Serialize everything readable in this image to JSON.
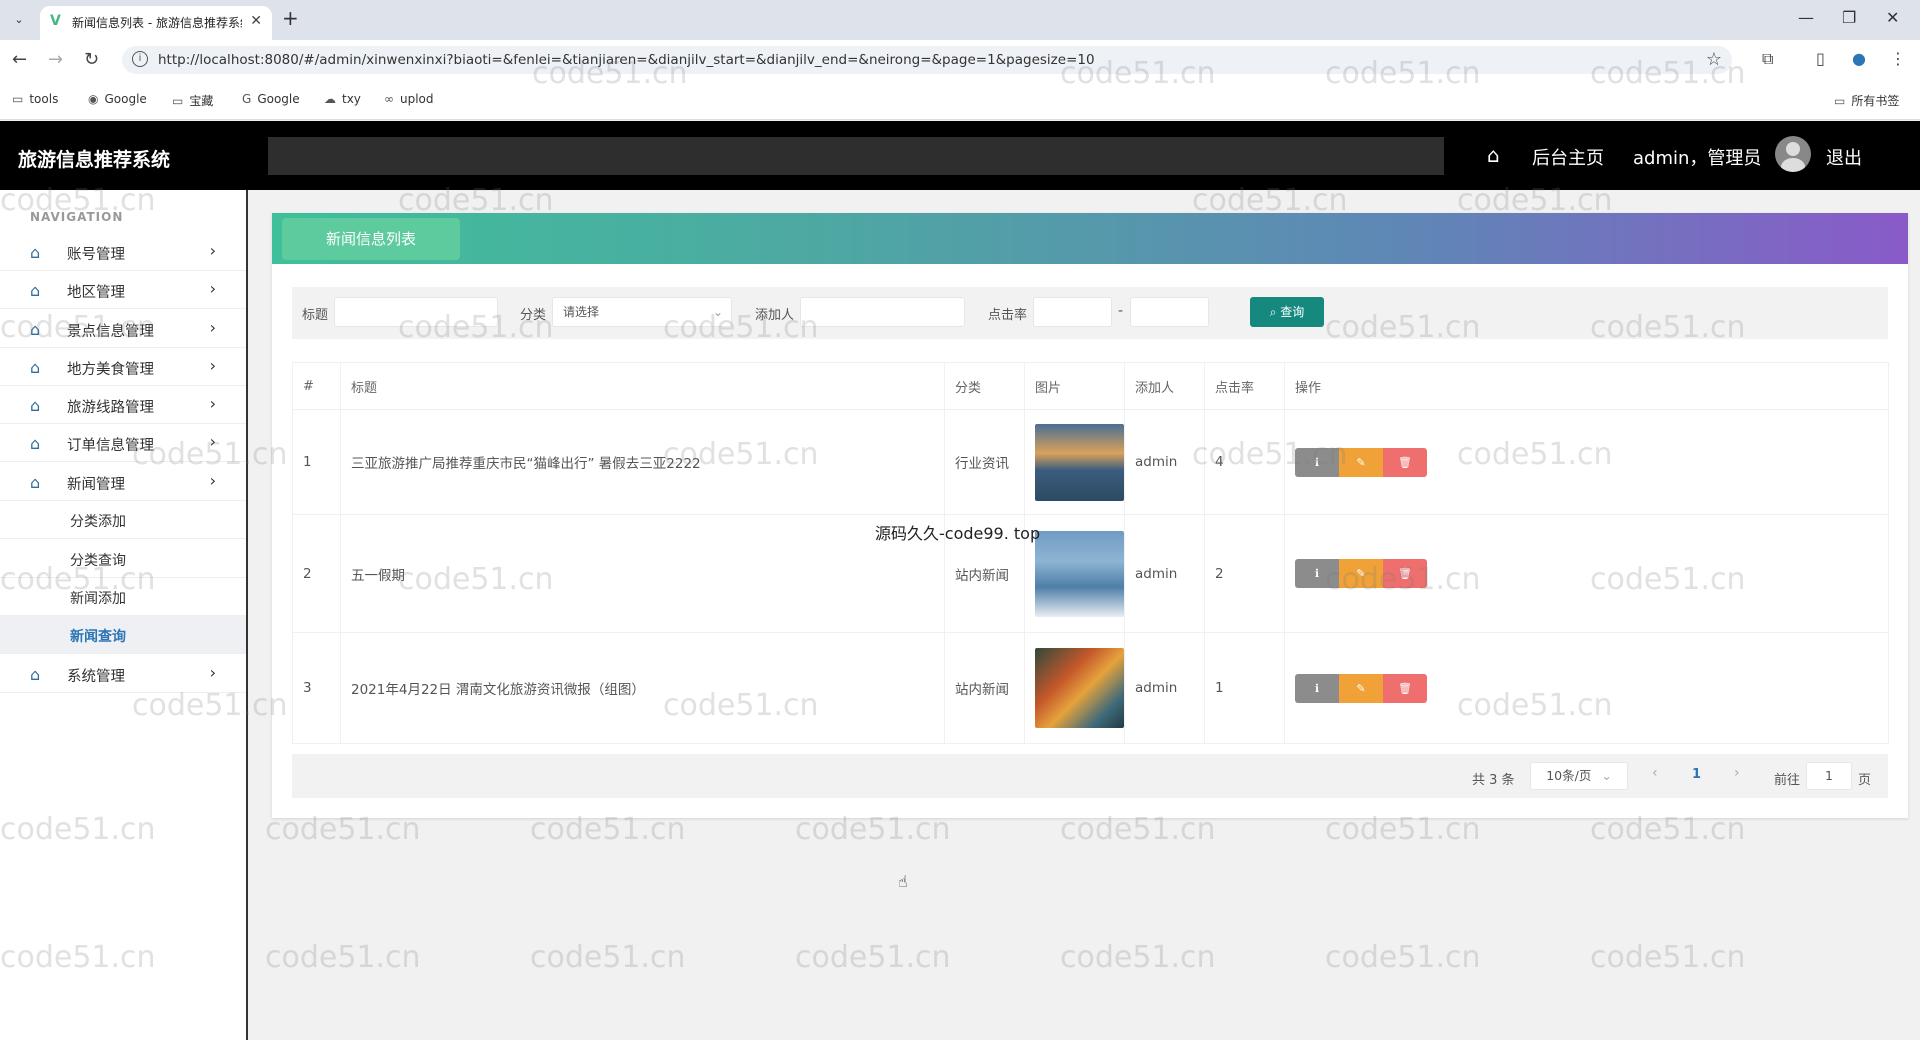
{
  "browser": {
    "tab_title": "新闻信息列表 - 旅游信息推荐系统",
    "tab_close": "✕",
    "new_tab": "+",
    "url": "http://localhost:8080/#/admin/xinwenxinxi?biaoti=&fenlei=&tianjiaren=&dianjilv_start=&dianjilv_end=&neirong=&page=1&pagesize=10",
    "bookmarks": [
      "tools",
      "Google",
      "宝藏",
      "Google",
      "txy",
      "uplod"
    ],
    "all_bookmarks": "所有书签"
  },
  "header": {
    "brand": "旅游信息推荐系统",
    "home_link": "后台主页",
    "user": "admin，管理员",
    "logout": "退出"
  },
  "sidebar": {
    "nav_title": "NAVIGATION",
    "items": [
      {
        "label": "账号管理"
      },
      {
        "label": "地区管理"
      },
      {
        "label": "景点信息管理"
      },
      {
        "label": "地方美食管理"
      },
      {
        "label": "旅游线路管理"
      },
      {
        "label": "订单信息管理"
      },
      {
        "label": "新闻管理"
      },
      {
        "label": "系统管理"
      }
    ],
    "subitems": [
      {
        "label": "分类添加"
      },
      {
        "label": "分类查询"
      },
      {
        "label": "新闻添加"
      },
      {
        "label": "新闻查询"
      }
    ]
  },
  "page": {
    "banner_title": "新闻信息列表"
  },
  "search": {
    "title_label": "标题",
    "category_label": "分类",
    "category_placeholder": "请选择",
    "adder_label": "添加人",
    "clicks_label": "点击率",
    "range_dash": "-",
    "search_button": "查询"
  },
  "table": {
    "headers": [
      "#",
      "标题",
      "分类",
      "图片",
      "添加人",
      "点击率",
      "操作"
    ],
    "rows": [
      {
        "index": "1",
        "title": "三亚旅游推广局推荐重庆市民“猫峰出行” 暑假去三亚2222",
        "category": "行业资讯",
        "adder": "admin",
        "clicks": "4",
        "image": "sunset-sea-photo"
      },
      {
        "index": "2",
        "title": "五一假期",
        "category": "站内新闻",
        "adder": "admin",
        "clicks": "2",
        "image": "seaside-birds-photo"
      },
      {
        "index": "3",
        "title": "2021年4月22日 渭南文化旅游资讯微报（组图）",
        "category": "站内新闻",
        "adder": "admin",
        "clicks": "1",
        "image": "autumn-lake-photo"
      }
    ]
  },
  "pagination": {
    "total": "共 3 条",
    "page_size": "10条/页",
    "current_page": "1",
    "goto_label": "前往",
    "goto_value": "1",
    "page_suffix": "页"
  },
  "overlay": {
    "watermark_text": "源码久久-code99. top",
    "repeated_watermark": "code51.cn"
  },
  "colors": {
    "header_bg": "#000000",
    "accent": "#16897f",
    "banner_start": "#3fbf9a",
    "banner_end": "#8a5ac9",
    "view_btn": "#8c8c8c",
    "edit_btn": "#f0a238",
    "delete_btn": "#ef6f6f"
  }
}
